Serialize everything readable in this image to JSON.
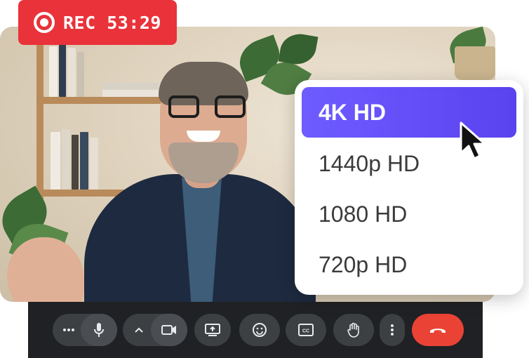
{
  "recording": {
    "label": "REC 53:29",
    "color": "#e9323a"
  },
  "resolution_menu": {
    "items": [
      {
        "label": "4K HD",
        "selected": true
      },
      {
        "label": "1440p HD",
        "selected": false
      },
      {
        "label": "1080 HD",
        "selected": false
      },
      {
        "label": "720p HD",
        "selected": false
      }
    ],
    "accent": "#5a42f0"
  },
  "toolbar": {
    "buttons": [
      {
        "icon": "more-options-icon"
      },
      {
        "icon": "microphone-icon"
      },
      {
        "icon": "chevron-up-icon"
      },
      {
        "icon": "camera-icon"
      },
      {
        "icon": "present-screen-icon"
      },
      {
        "icon": "emoji-icon"
      },
      {
        "icon": "captions-icon"
      },
      {
        "icon": "raise-hand-icon"
      },
      {
        "icon": "more-vert-icon"
      },
      {
        "icon": "end-call-icon"
      }
    ],
    "end_call_color": "#ea4335"
  }
}
